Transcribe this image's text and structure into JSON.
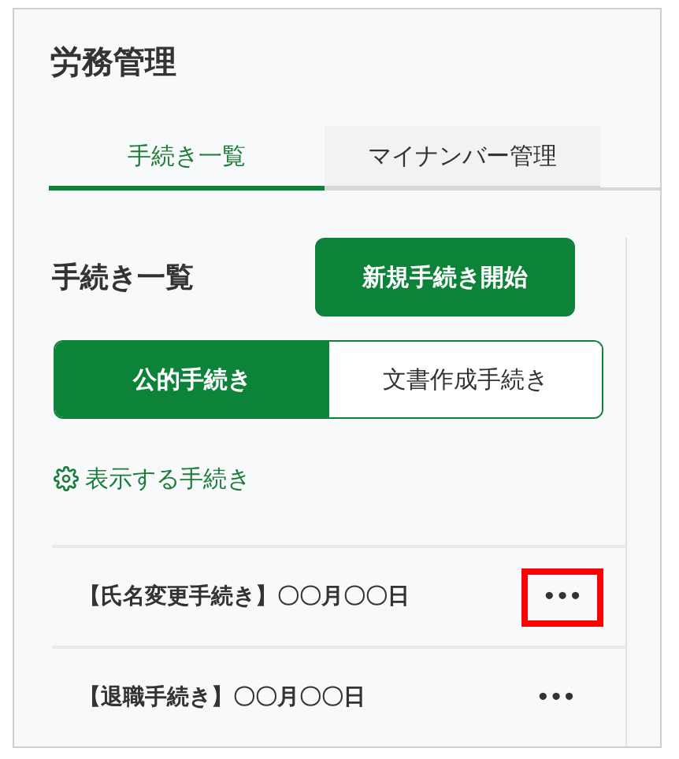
{
  "page": {
    "title": "労務管理"
  },
  "tabs": [
    {
      "label": "手続き一覧",
      "selected": true
    },
    {
      "label": "マイナンバー管理",
      "selected": false
    }
  ],
  "panel": {
    "heading": "手続き一覧",
    "new_button": "新規手続き開始",
    "segments": [
      {
        "label": "公的手続き",
        "selected": true
      },
      {
        "label": "文書作成手続き",
        "selected": false
      }
    ],
    "settings_link": "表示する手続き",
    "items": [
      {
        "name": "【氏名変更手続き】",
        "date": "〇〇月〇〇日",
        "menu": "•••",
        "highlighted": true
      },
      {
        "name": "【退職手続き】",
        "date": "〇〇月〇〇日",
        "menu": "•••",
        "highlighted": false
      }
    ]
  }
}
